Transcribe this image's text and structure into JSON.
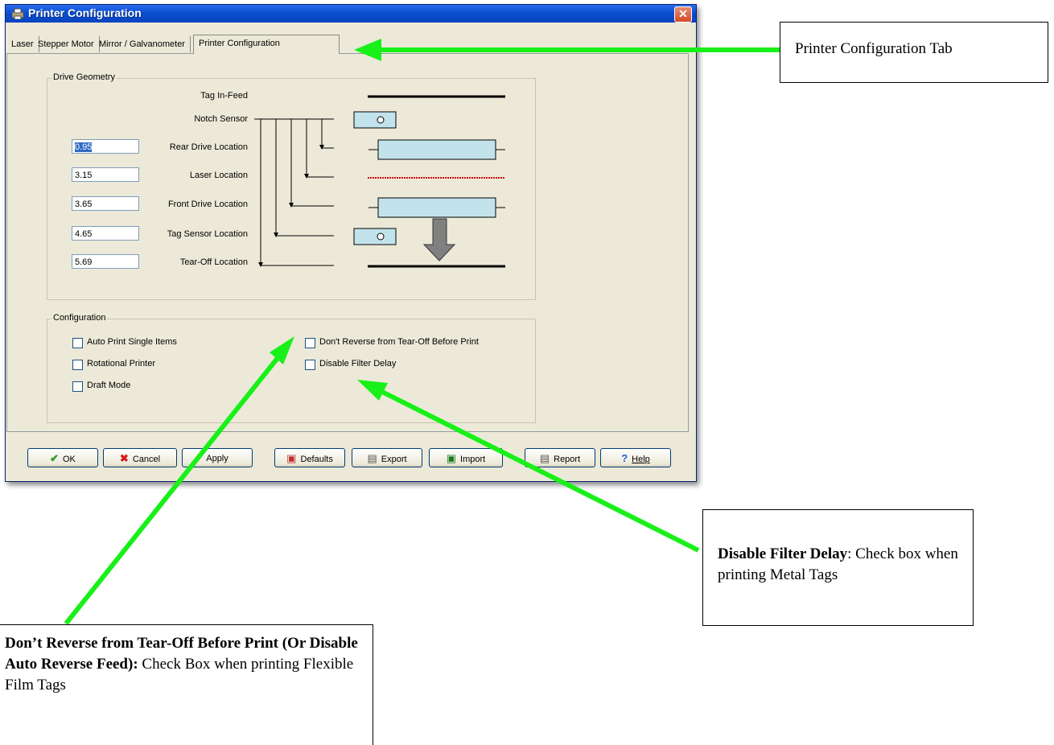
{
  "window": {
    "title": "Printer Configuration",
    "close_glyph": "✕"
  },
  "tabs": [
    {
      "label": "Laser"
    },
    {
      "label": "Stepper Motor"
    },
    {
      "label": "Mirror / Galvanometer"
    },
    {
      "label": "Printer Configuration",
      "active": true
    }
  ],
  "drive_geometry": {
    "title": "Drive Geometry",
    "rows": [
      {
        "label": "Tag In-Feed"
      },
      {
        "label": "Notch Sensor"
      },
      {
        "label": "Rear Drive Location",
        "value": "0.95"
      },
      {
        "label": "Laser Location",
        "value": "3.15"
      },
      {
        "label": "Front Drive Location",
        "value": "3.65"
      },
      {
        "label": "Tag Sensor Location",
        "value": "4.65"
      },
      {
        "label": "Tear-Off Location",
        "value": "5.69"
      }
    ]
  },
  "configuration": {
    "title": "Configuration",
    "options": [
      {
        "label": "Auto Print Single Items",
        "checked": false
      },
      {
        "label": "Rotational Printer",
        "checked": false
      },
      {
        "label": "Draft Mode",
        "checked": false
      },
      {
        "label": "Don't Reverse from Tear-Off Before Print",
        "checked": false
      },
      {
        "label": "Disable Filter Delay",
        "checked": false
      }
    ]
  },
  "buttons": [
    {
      "label": "OK",
      "icon": "check-icon"
    },
    {
      "label": "Cancel",
      "icon": "x-icon"
    },
    {
      "label": "Apply"
    },
    {
      "label": "Defaults",
      "icon": "defaults-icon"
    },
    {
      "label": "Export",
      "icon": "export-icon"
    },
    {
      "label": "Import",
      "icon": "import-icon"
    },
    {
      "label": "Report",
      "icon": "report-icon"
    },
    {
      "label": "Help",
      "icon": "help-icon"
    }
  ],
  "callouts": {
    "tab": "Printer Configuration Tab",
    "filter_delay": {
      "bold": "Disable Filter Delay",
      "text": ": Check box when printing Metal Tags"
    },
    "reverse": {
      "bold": "Don’t Reverse from Tear-Off Before Print (Or Disable Auto Reverse Feed):",
      "text": " Check Box when printing Flexible Film Tags"
    }
  },
  "colors": {
    "arrow": "#19f019",
    "titlebar": "#0a4fd0",
    "box_fill": "#c2e3ec",
    "laser_line": "#cc0000"
  }
}
